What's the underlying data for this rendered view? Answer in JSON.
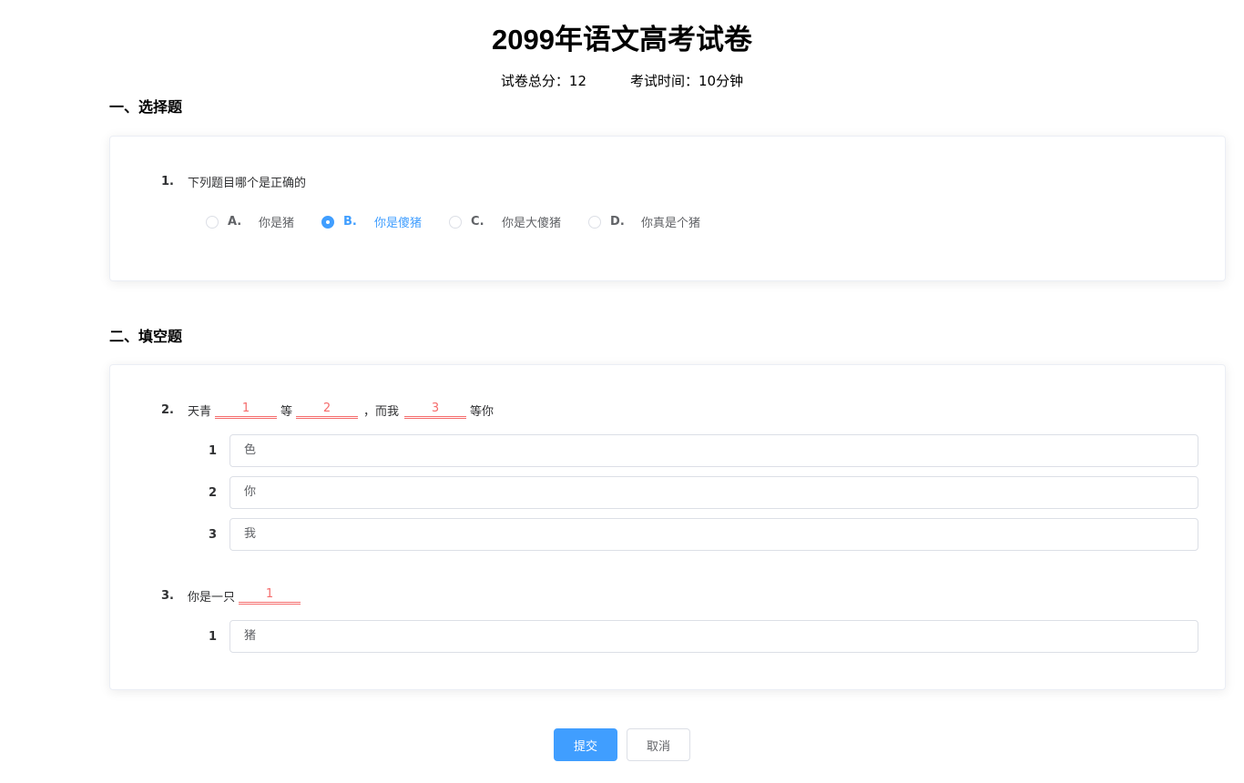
{
  "exam": {
    "title": "2099年语文高考试卷",
    "total_score_label": "试卷总分：12",
    "duration_label": "考试时间：10分钟"
  },
  "section_choice": {
    "heading": "一、选择题",
    "question": {
      "number": "1.",
      "text": "下列题目哪个是正确的",
      "selected": "B",
      "options": [
        {
          "letter": "A.",
          "text": "你是猪"
        },
        {
          "letter": "B.",
          "text": "你是傻猪"
        },
        {
          "letter": "C.",
          "text": "你是大傻猪"
        },
        {
          "letter": "D.",
          "text": "你真是个猪"
        }
      ]
    }
  },
  "section_fill": {
    "heading": "二、填空题",
    "q2": {
      "number": "2.",
      "parts": [
        "天青",
        "等",
        "，而我",
        "等你"
      ],
      "blanks": [
        "1",
        "2",
        "3"
      ],
      "answers": [
        {
          "label": "1",
          "value": "色"
        },
        {
          "label": "2",
          "value": "你"
        },
        {
          "label": "3",
          "value": "我"
        }
      ]
    },
    "q3": {
      "number": "3.",
      "parts": [
        "你是一只"
      ],
      "blanks": [
        "1"
      ],
      "answers": [
        {
          "label": "1",
          "value": "猪"
        }
      ]
    }
  },
  "actions": {
    "submit_label": "提交",
    "cancel_label": "取消"
  },
  "colors": {
    "primary": "#409eff",
    "blank": "#f56c6c"
  }
}
